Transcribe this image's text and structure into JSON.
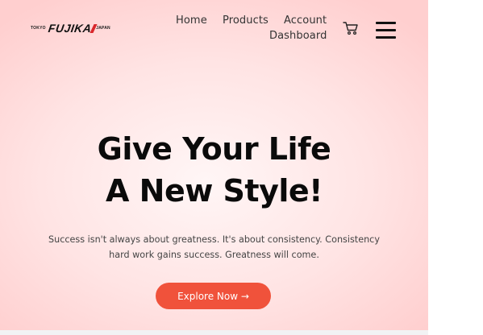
{
  "logo": {
    "left_text": "TOKYO",
    "brand": "FUJIKA",
    "right_text": "JAPAN"
  },
  "nav": {
    "home": "Home",
    "products": "Products",
    "account": "Account",
    "dashboard": "Dashboard"
  },
  "icons": {
    "cart": "shopping-cart-icon",
    "menu": "hamburger-menu-icon"
  },
  "hero": {
    "headline_line1": "Give Your Life",
    "headline_line2": "A New Style!",
    "subtext_line1": "Success isn't always about greatness. It's about consistency. Consistency",
    "subtext_line2": "hard work gains success. Greatness will come.",
    "cta_label": "Explore Now →"
  },
  "colors": {
    "accent": "#f0523b",
    "hero_background": "#ffd6d6",
    "text_dark": "#0a0a0a"
  }
}
